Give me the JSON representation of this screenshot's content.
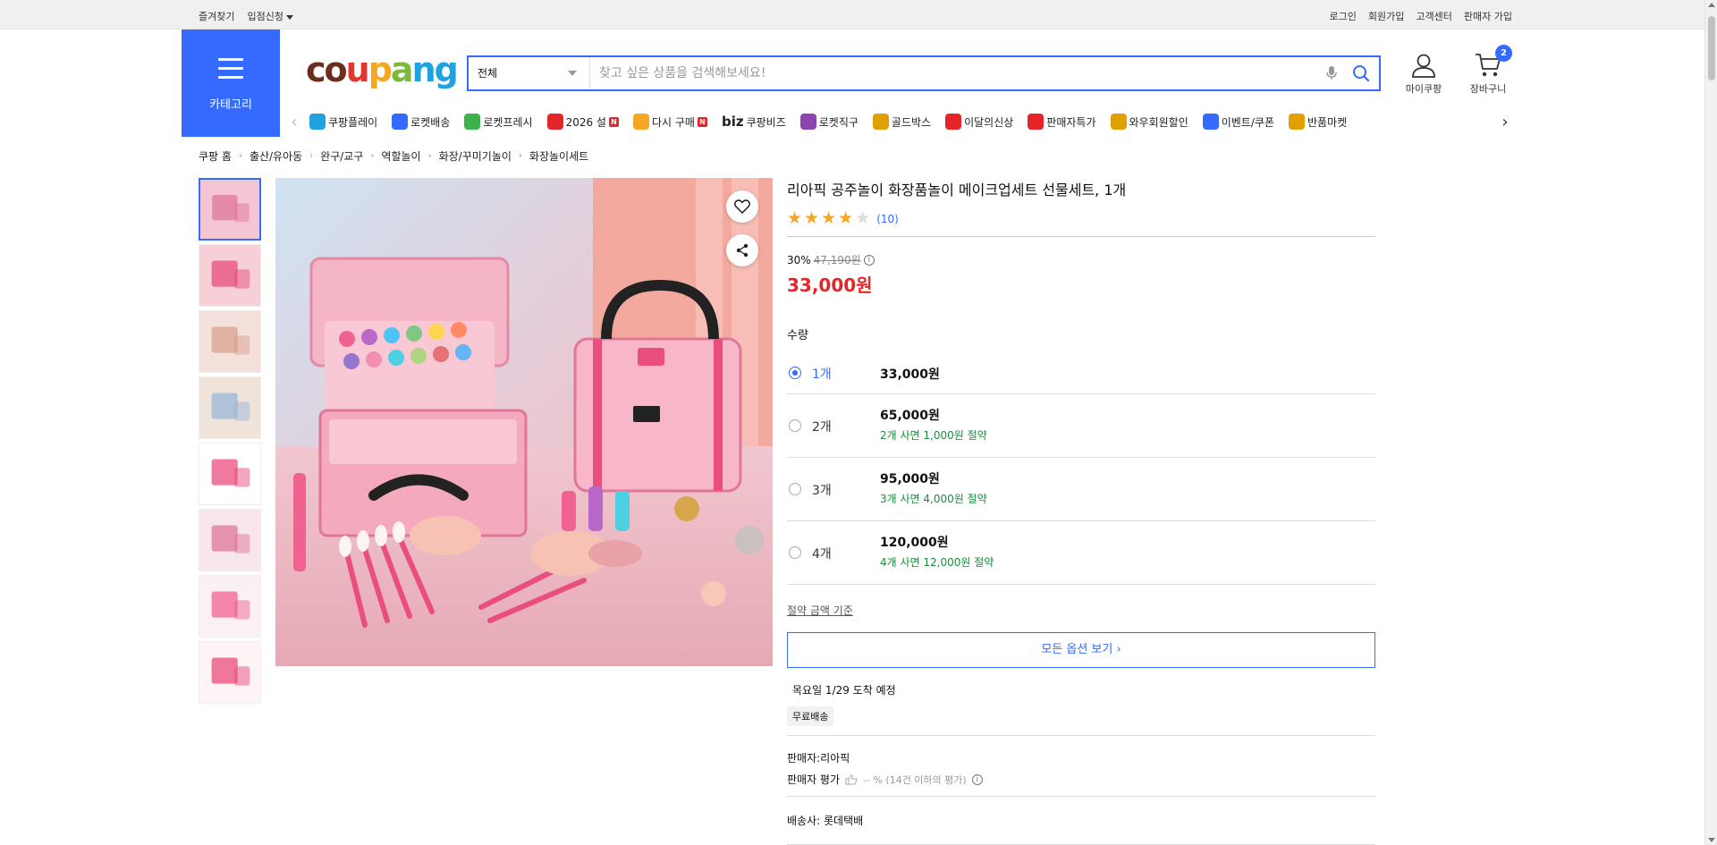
{
  "topbar": {
    "left": [
      "즐겨찾기",
      "입점신청"
    ],
    "right": [
      "로그인",
      "회원가입",
      "고객센터",
      "판매자 가입"
    ]
  },
  "header": {
    "category_label": "카테고리",
    "logo_text": "coupang",
    "search_category": "전체",
    "search_placeholder": "찾고 싶은 상품을 검색해보세요!",
    "mycoupang_label": "마이쿠팡",
    "cart_label": "장바구니",
    "cart_count": "2"
  },
  "nav": {
    "items": [
      {
        "label": "쿠팡플레이",
        "icon": "play-icon",
        "color": "#1fa3e0"
      },
      {
        "label": "로켓배송",
        "icon": "rocket-icon",
        "color": "#346aff"
      },
      {
        "label": "로켓프레시",
        "icon": "rocket-fresh-icon",
        "color": "#3bb34a"
      },
      {
        "label": "2026 설",
        "icon": "gift-icon",
        "color": "#e52528",
        "badge": "N"
      },
      {
        "label": "다시 구매",
        "icon": "rebuy-icon",
        "color": "#f5a623",
        "badge": "N"
      },
      {
        "label": "쿠팡비즈",
        "prefix": "biz",
        "icon": "biz-icon",
        "color": "#222"
      },
      {
        "label": "로켓직구",
        "icon": "global-icon",
        "color": "#8e44ad"
      },
      {
        "label": "골드박스",
        "icon": "goldbox-icon",
        "color": "#e0a100"
      },
      {
        "label": "이달의신상",
        "icon": "new-product-icon",
        "color": "#e52528"
      },
      {
        "label": "판매자특가",
        "icon": "seller-deal-icon",
        "color": "#e52528"
      },
      {
        "label": "와우회원할인",
        "icon": "wow-icon",
        "color": "#e0a100"
      },
      {
        "label": "이벤트/쿠폰",
        "icon": "coupon-icon",
        "color": "#346aff"
      },
      {
        "label": "반품마켓",
        "icon": "return-market-icon",
        "color": "#e0a100"
      }
    ]
  },
  "breadcrumb": [
    "쿠팡 홈",
    "출산/유아동",
    "완구/교구",
    "역할놀이",
    "화장/꾸미기놀이",
    "화장놀이세트"
  ],
  "product": {
    "title": "리아픽 공주놀이 화장품놀이 메이크업세트 선물세트, 1개",
    "rating": 4,
    "review_count": "(10)",
    "discount_rate": "30%",
    "original_price": "47,190원",
    "price": "33,000원",
    "quantity_label": "수량",
    "options": [
      {
        "qty": "1개",
        "price": "33,000원",
        "saving": "",
        "selected": true
      },
      {
        "qty": "2개",
        "price": "65,000원",
        "saving": "2개 사면 1,000원 절약",
        "selected": false
      },
      {
        "qty": "3개",
        "price": "95,000원",
        "saving": "3개 사면 4,000원 절약",
        "selected": false
      },
      {
        "qty": "4개",
        "price": "120,000원",
        "saving": "4개 사면 12,000원 절약",
        "selected": false
      }
    ],
    "saving_basis_link": "절약 금액 기준",
    "all_options_button": "모든 옵션 보기 ›",
    "delivery_date": "목요일 1/29 도착 예정",
    "free_shipping": "무료배송",
    "seller_label": "판매자:",
    "seller_name": "리아픽",
    "seller_eval_label": "판매자 평가",
    "seller_eval_value": "-- % (14건 이하의 평가)",
    "shipper_label": "배송사:",
    "shipper_name": "롯데택배"
  }
}
